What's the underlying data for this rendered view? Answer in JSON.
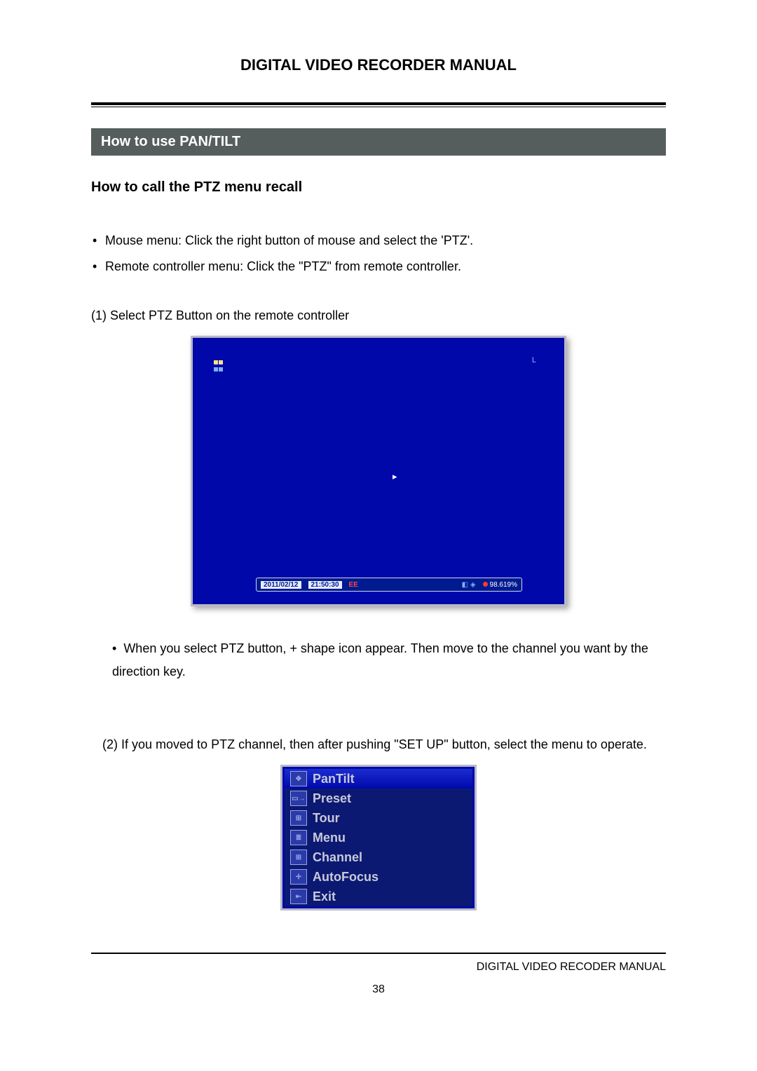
{
  "header": {
    "title": "DIGITAL VIDEO RECORDER MANUAL"
  },
  "section": {
    "banner": "How to use PAN/TILT",
    "subheading": "How to call the PTZ menu recall"
  },
  "bullets": [
    "Mouse menu: Click the right button of mouse and select the 'PTZ'.",
    "Remote controller menu: Click the \"PTZ\" from remote controller."
  ],
  "step1": {
    "text": "(1) Select PTZ Button on the remote controller"
  },
  "screenshot1": {
    "corner_label": "L",
    "cursor": "▸",
    "status": {
      "date": "2011/02/12",
      "time": "21:50:30",
      "rec": "EE",
      "pct": "98.619%"
    }
  },
  "para_after1": "When you select PTZ button, + shape icon appear. Then move to the channel you want by the direction key.",
  "step2": {
    "text": "(2) If you moved to PTZ channel, then after pushing \"SET UP\" button, select the menu to operate."
  },
  "ptz_menu": {
    "items": [
      {
        "label": "PanTilt",
        "selected": true,
        "icon": "ptz"
      },
      {
        "label": "Preset",
        "selected": false,
        "icon": "preset"
      },
      {
        "label": "Tour",
        "selected": false,
        "icon": "tour"
      },
      {
        "label": "Menu",
        "selected": false,
        "icon": "menu"
      },
      {
        "label": "Channel",
        "selected": false,
        "icon": "channel"
      },
      {
        "label": "AutoFocus",
        "selected": false,
        "icon": "autofocus"
      },
      {
        "label": "Exit",
        "selected": false,
        "icon": "exit"
      }
    ]
  },
  "footer": {
    "right": "DIGITAL VIDEO RECODER MANUAL",
    "page": "38"
  }
}
